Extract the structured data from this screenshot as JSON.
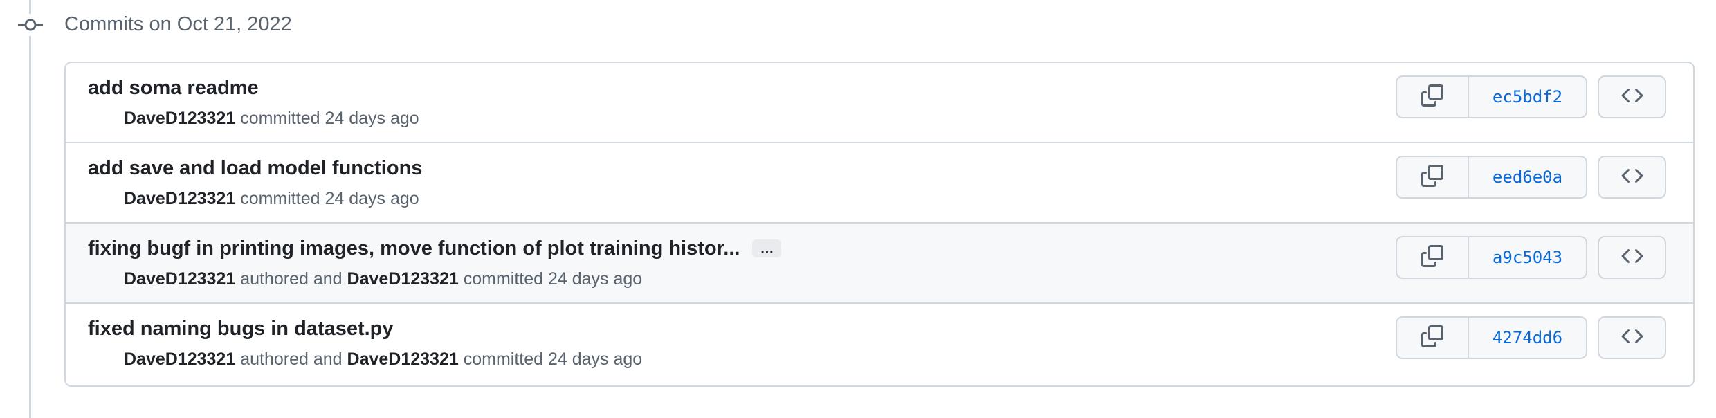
{
  "group": {
    "title": "Commits on Oct 21, 2022"
  },
  "commits": [
    {
      "title": "add soma readme",
      "author": "DaveD123321",
      "authored_text": "",
      "committer": "",
      "committed_text": "committed 24 days ago",
      "sha": "ec5bdf2",
      "has_ellipsis": false
    },
    {
      "title": "add save and load model functions",
      "author": "DaveD123321",
      "authored_text": "",
      "committer": "",
      "committed_text": "committed 24 days ago",
      "sha": "eed6e0a",
      "has_ellipsis": false
    },
    {
      "title": "fixing bugf in printing images, move function of plot training histor...",
      "author": "DaveD123321",
      "authored_text": "authored and",
      "committer": "DaveD123321",
      "committed_text": "committed 24 days ago",
      "sha": "a9c5043",
      "has_ellipsis": true,
      "ellipsis_label": "…"
    },
    {
      "title": "fixed naming bugs in dataset.py",
      "author": "DaveD123321",
      "authored_text": "authored and",
      "committer": "DaveD123321",
      "committed_text": "committed 24 days ago",
      "sha": "4274dd6",
      "has_ellipsis": false
    }
  ],
  "icons": {
    "timeline": "git-commit-icon",
    "copy": "copy-icon",
    "browse": "code-icon"
  },
  "colors": {
    "sha_link": "#0969da",
    "border": "#d0d7de",
    "highlight_row": "#f6f8fa",
    "muted_text": "#59636e"
  }
}
